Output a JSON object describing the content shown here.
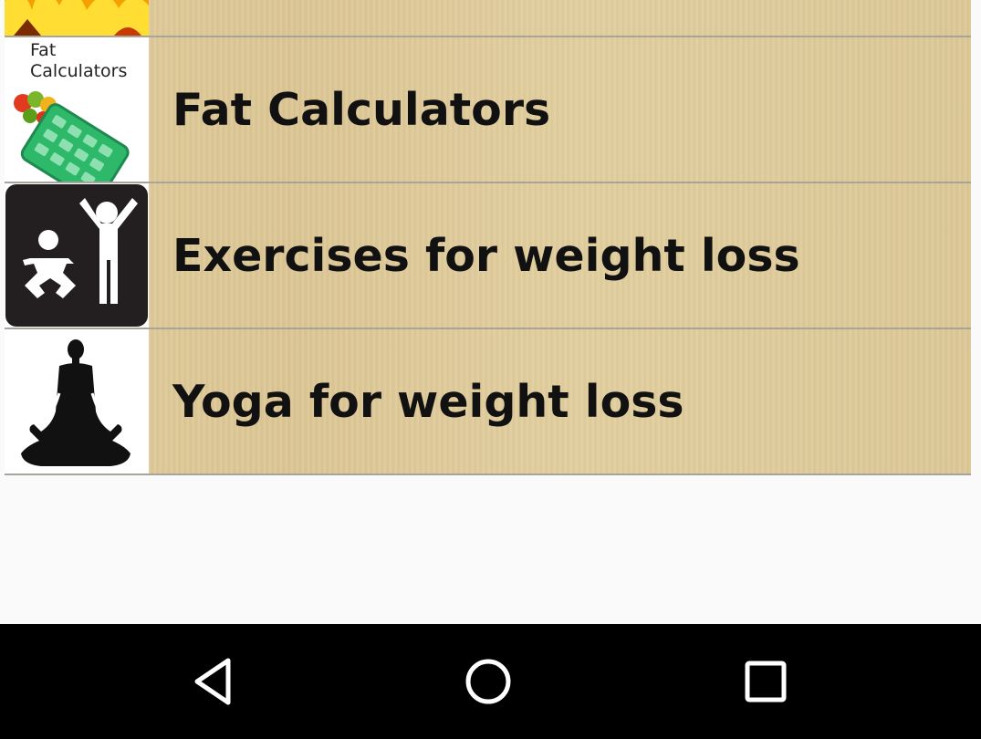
{
  "list": {
    "items": [
      {
        "label": "",
        "icon": "fire-icon"
      },
      {
        "label": "Fat Calculators",
        "icon": "calculator-icon",
        "thumb_text_line1": "Fat",
        "thumb_text_line2": "Calculators"
      },
      {
        "label": "Exercises for weight loss",
        "icon": "exercise-icon"
      },
      {
        "label": "Yoga for weight loss",
        "icon": "yoga-icon"
      }
    ]
  },
  "navbar": {
    "back": "back-icon",
    "home": "home-icon",
    "recents": "recents-icon"
  },
  "colors": {
    "row_bg": "#dfca98",
    "divider": "#a7a49c",
    "text": "#111111",
    "page_bg": "#fafafa",
    "navbar_bg": "#000000"
  }
}
